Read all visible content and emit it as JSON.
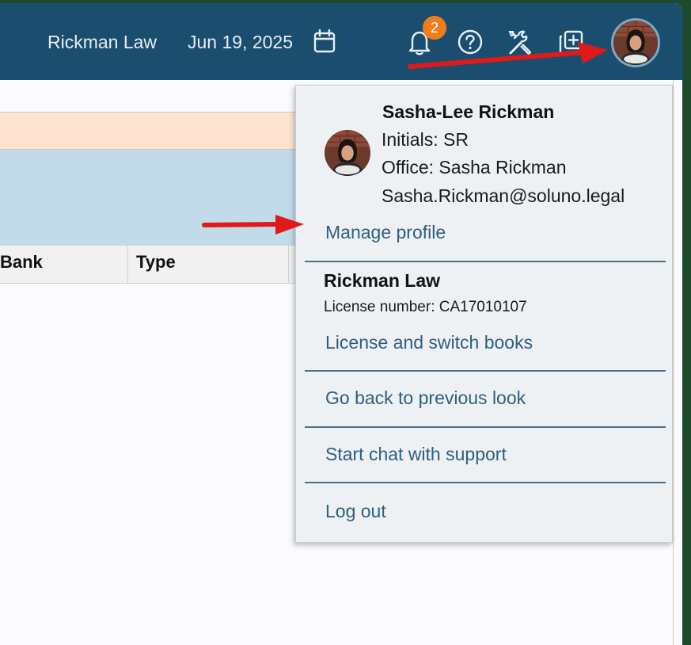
{
  "header": {
    "firm_name": "Rickman Law",
    "date": "Jun 19, 2025",
    "notification_count": "2",
    "colors": {
      "bar": "#1b4e6e",
      "badge": "#f07d1a"
    },
    "icons": [
      "calendar-icon",
      "bell-icon",
      "help-icon",
      "tools-icon",
      "add-window-icon",
      "avatar"
    ]
  },
  "table": {
    "columns": [
      "Bank",
      "Type"
    ]
  },
  "menu": {
    "user": {
      "name": "Sasha-Lee Rickman",
      "initials": "Initials: SR",
      "office": "Office: Sasha Rickman",
      "email": "Sasha.Rickman@soluno.legal"
    },
    "manage_profile": "Manage profile",
    "firm": {
      "name": "Rickman Law",
      "license": "License number: CA17010107"
    },
    "license_switch": "License and switch books",
    "previous_look": "Go back to previous look",
    "support_chat": "Start chat with support",
    "logout": "Log out",
    "link_color": "#2e5f7e"
  },
  "annotations": {
    "arrow_color": "#e0191b"
  }
}
